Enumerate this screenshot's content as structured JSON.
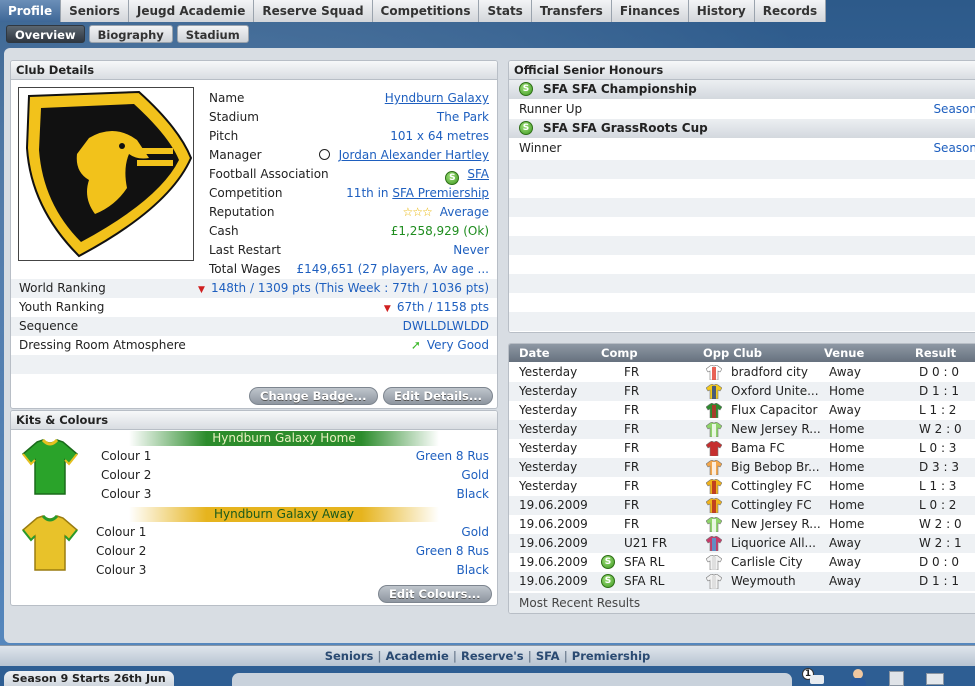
{
  "top_tabs": [
    "Profile",
    "Seniors",
    "Jeugd Academie",
    "Reserve Squad",
    "Competitions",
    "Stats",
    "Transfers",
    "Finances",
    "History",
    "Records"
  ],
  "sub_tabs": [
    "Overview",
    "Biography",
    "Stadium"
  ],
  "club_details": {
    "header": "Club Details",
    "rows": [
      {
        "label": "Name",
        "value": "Hyndburn Galaxy"
      },
      {
        "label": "Stadium",
        "value": "The Park"
      },
      {
        "label": "Pitch",
        "value": "101 x 64 metres"
      },
      {
        "label": "Manager",
        "value": "Jordan Alexander Hartley"
      },
      {
        "label": "Football Association",
        "value": "SFA"
      },
      {
        "label": "Competition",
        "value_prefix": "11th in ",
        "value": "SFA Premiership"
      },
      {
        "label": "Reputation",
        "value": "Average"
      },
      {
        "label": "Cash",
        "value": "£1,258,929 (Ok)"
      },
      {
        "label": "Last Restart",
        "value": "Never"
      },
      {
        "label": "Total Wages",
        "value": "£149,651 (27 players, Av age ..."
      }
    ],
    "wide_rows": [
      {
        "label": "World Ranking",
        "value": "148th / 1309 pts (This Week : 77th / 1036 pts)"
      },
      {
        "label": "Youth Ranking",
        "value": "67th / 1158 pts"
      },
      {
        "label": "Sequence",
        "value": "DWLLDLWLDD"
      },
      {
        "label": "Dressing Room Atmosphere",
        "value": "Very Good"
      }
    ],
    "buttons": {
      "change_badge": "Change Badge...",
      "edit_details": "Edit Details..."
    }
  },
  "kits": {
    "header": "Kits & Colours",
    "home": {
      "title": "Hyndburn Galaxy Home",
      "colours": [
        {
          "label": "Colour 1",
          "value": "Green 8 Rus"
        },
        {
          "label": "Colour 2",
          "value": "Gold"
        },
        {
          "label": "Colour 3",
          "value": "Black"
        }
      ]
    },
    "away": {
      "title": "Hyndburn Galaxy Away",
      "colours": [
        {
          "label": "Colour 1",
          "value": "Gold"
        },
        {
          "label": "Colour 2",
          "value": "Green 8 Rus"
        },
        {
          "label": "Colour 3",
          "value": "Black"
        }
      ]
    },
    "edit_button": "Edit Colours..."
  },
  "honours": {
    "header": "Official Senior Honours",
    "items": [
      {
        "title": "SFA SFA Championship",
        "result": "Runner Up",
        "link": "Season"
      },
      {
        "title": "SFA SFA GrassRoots Cup",
        "result": "Winner",
        "link": "Season"
      }
    ]
  },
  "results": {
    "headers": {
      "date": "Date",
      "comp": "Comp",
      "opp": "Opp Club",
      "venue": "Venue",
      "result": "Result"
    },
    "footer": "Most Recent Results",
    "rows": [
      {
        "date": "Yesterday",
        "comp": "FR",
        "opp": "bradford city",
        "venue": "Away",
        "result": "D 0 : 0",
        "shirt": [
          "#ffffff",
          "#e23b2b"
        ],
        "sfa": false
      },
      {
        "date": "Yesterday",
        "comp": "FR",
        "opp": "Oxford Unite...",
        "venue": "Home",
        "result": "D 1 : 1",
        "shirt": [
          "#f2c81c",
          "#1e3f8f"
        ],
        "sfa": false
      },
      {
        "date": "Yesterday",
        "comp": "FR",
        "opp": "Flux Capacitor",
        "venue": "Away",
        "result": "L 1 : 2",
        "shirt": [
          "#2d8b2d",
          "#c52a2a"
        ],
        "sfa": false
      },
      {
        "date": "Yesterday",
        "comp": "FR",
        "opp": "New Jersey R...",
        "venue": "Home",
        "result": "W 2 : 0",
        "shirt": [
          "#8fd46a",
          "#ffffff"
        ],
        "sfa": false
      },
      {
        "date": "Yesterday",
        "comp": "FR",
        "opp": "Bama FC",
        "venue": "Home",
        "result": "L 0 : 3",
        "shirt": [
          "#c62f2f",
          "#c62f2f"
        ],
        "sfa": false
      },
      {
        "date": "Yesterday",
        "comp": "FR",
        "opp": "Big Bebop Br...",
        "venue": "Home",
        "result": "D 3 : 3",
        "shirt": [
          "#f3a64a",
          "#ffffff"
        ],
        "sfa": false
      },
      {
        "date": "Yesterday",
        "comp": "FR",
        "opp": "Cottingley FC",
        "venue": "Home",
        "result": "L 1 : 3",
        "shirt": [
          "#f0b21a",
          "#b5241f"
        ],
        "sfa": false
      },
      {
        "date": "19.06.2009",
        "comp": "FR",
        "opp": "Cottingley FC",
        "venue": "Home",
        "result": "L 0 : 2",
        "shirt": [
          "#f0b21a",
          "#b5241f"
        ],
        "sfa": false
      },
      {
        "date": "19.06.2009",
        "comp": "FR",
        "opp": "New Jersey R...",
        "venue": "Home",
        "result": "W 2 : 0",
        "shirt": [
          "#8fd46a",
          "#ffffff"
        ],
        "sfa": false
      },
      {
        "date": "19.06.2009",
        "comp": "U21 FR",
        "opp": "Liquorice All...",
        "venue": "Away",
        "result": "W 2 : 1",
        "shirt": [
          "#c93a6a",
          "#4aa3d8"
        ],
        "sfa": false
      },
      {
        "date": "19.06.2009",
        "comp": "SFA RL",
        "opp": "Carlisle City",
        "venue": "Away",
        "result": "D 0 : 0",
        "shirt": [
          "#f2f2f2",
          "#d9d9d9"
        ],
        "sfa": true
      },
      {
        "date": "19.06.2009",
        "comp": "SFA RL",
        "opp": "Weymouth",
        "venue": "Away",
        "result": "D 1 : 1",
        "shirt": [
          "#f2f2f2",
          "#d9d9d9"
        ],
        "sfa": true
      }
    ]
  },
  "bottom_nav": [
    "Seniors",
    "Academie",
    "Reserve's",
    "SFA",
    "Premiership"
  ],
  "status": {
    "text": "Season 9 Starts 26th Jun",
    "badge_count": "1"
  }
}
